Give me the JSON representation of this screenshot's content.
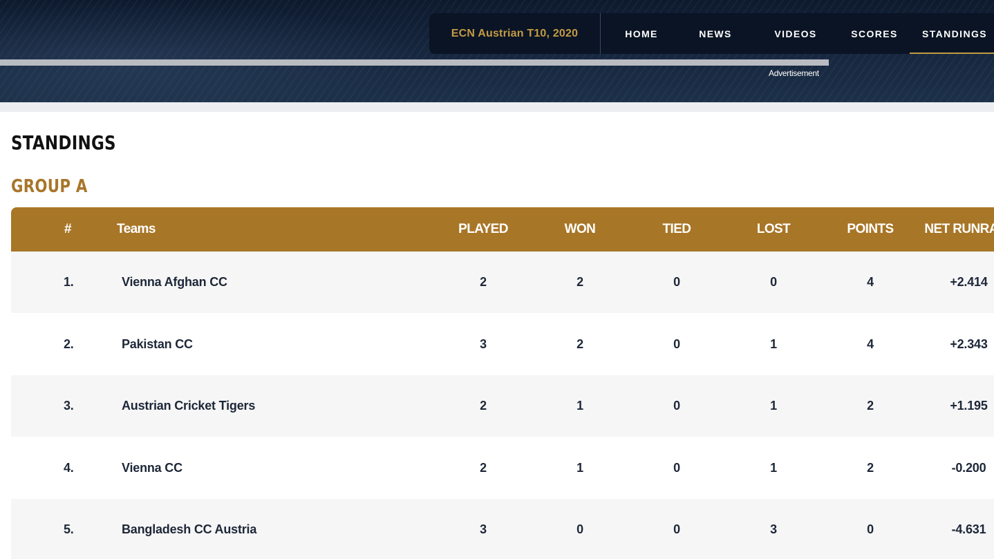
{
  "header": {
    "brand": "ECN Austrian T10, 2020",
    "nav": [
      {
        "label": "HOME",
        "active": false
      },
      {
        "label": "NEWS",
        "active": false
      },
      {
        "label": "VIDEOS",
        "active": false
      },
      {
        "label": "SCORES",
        "active": false
      },
      {
        "label": "STANDINGS",
        "active": true
      }
    ],
    "ad_label": "Advertisement",
    "accent_color": "#c49a45"
  },
  "page_title": "STANDINGS",
  "group": {
    "title": "GROUP A",
    "columns": [
      "#",
      "Teams",
      "PLAYED",
      "WON",
      "TIED",
      "LOST",
      "POINTS",
      "NET RUNRATE"
    ],
    "rows": [
      {
        "rank": "1.",
        "team": "Vienna Afghan CC",
        "played": "2",
        "won": "2",
        "tied": "0",
        "lost": "0",
        "points": "4",
        "nrr": "+2.414"
      },
      {
        "rank": "2.",
        "team": "Pakistan CC",
        "played": "3",
        "won": "2",
        "tied": "0",
        "lost": "1",
        "points": "4",
        "nrr": "+2.343"
      },
      {
        "rank": "3.",
        "team": "Austrian Cricket Tigers",
        "played": "2",
        "won": "1",
        "tied": "0",
        "lost": "1",
        "points": "2",
        "nrr": "+1.195"
      },
      {
        "rank": "4.",
        "team": "Vienna CC",
        "played": "2",
        "won": "1",
        "tied": "0",
        "lost": "1",
        "points": "2",
        "nrr": "-0.200"
      },
      {
        "rank": "5.",
        "team": "Bangladesh CC Austria",
        "played": "3",
        "won": "0",
        "tied": "0",
        "lost": "3",
        "points": "0",
        "nrr": "-4.631"
      }
    ],
    "header_color": "#a87627"
  }
}
